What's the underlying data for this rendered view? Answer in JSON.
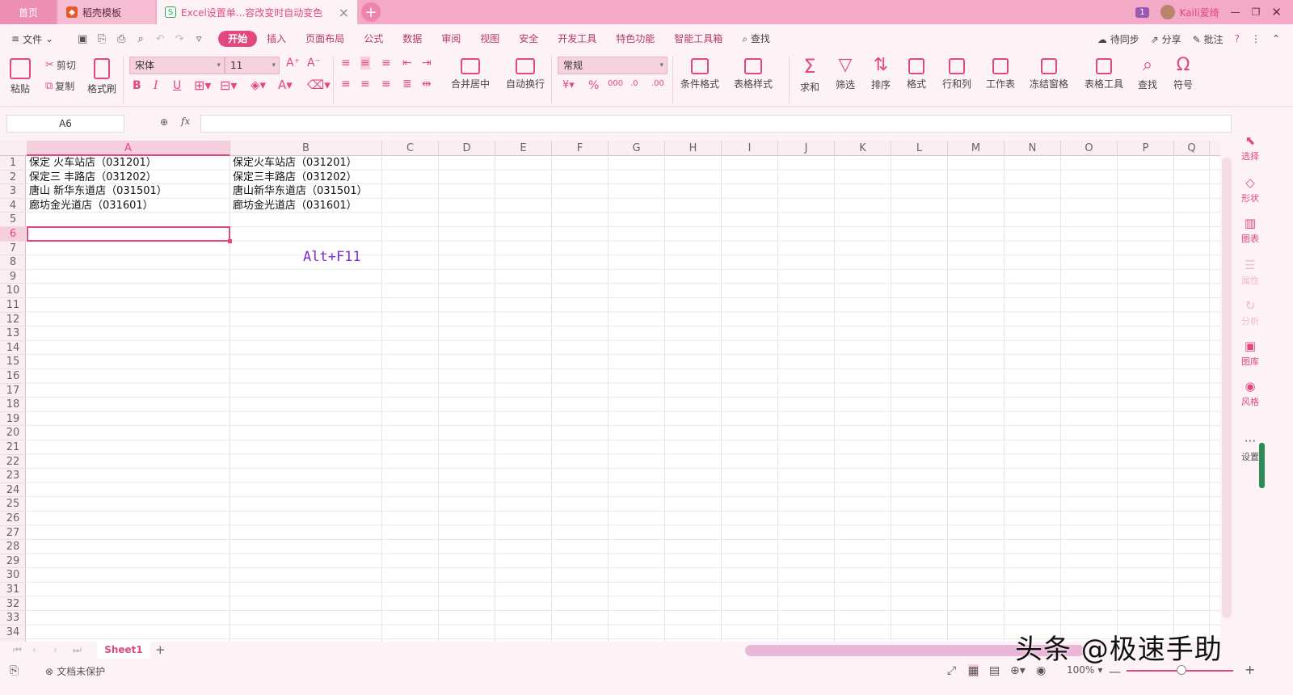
{
  "tabs": {
    "home": "首页",
    "template": "稻壳模板",
    "active_doc": "Excel设置单...容改变时自动变色",
    "new_tab_icon": "plus-icon"
  },
  "window": {
    "badge_count": "1",
    "username": "Kaili爱绮"
  },
  "menu": {
    "file": "文件",
    "tabs": [
      "开始",
      "插入",
      "页面布局",
      "公式",
      "数据",
      "审阅",
      "视图",
      "安全",
      "开发工具",
      "特色功能",
      "智能工具箱"
    ],
    "search": "查找",
    "sync": "待同步",
    "share": "分享",
    "comment": "批注"
  },
  "ribbon": {
    "paste": "粘贴",
    "cut": "剪切",
    "copy": "复制",
    "format_painter": "格式刷",
    "font_name": "宋体",
    "font_size": "11",
    "merge_center": "合并居中",
    "wrap_text": "自动换行",
    "number_format": "常规",
    "conditional_format": "条件格式",
    "table_style": "表格样式",
    "sum": "求和",
    "filter": "筛选",
    "sort": "排序",
    "format": "格式",
    "row_col": "行和列",
    "worksheet": "工作表",
    "freeze": "冻结窗格",
    "table_tools": "表格工具",
    "find": "查找",
    "symbol": "符号"
  },
  "formula_bar": {
    "name_box": "A6",
    "fx": "fx",
    "formula": ""
  },
  "grid": {
    "columns": [
      "A",
      "B",
      "C",
      "D",
      "E",
      "F",
      "G",
      "H",
      "I",
      "J",
      "K",
      "L",
      "M",
      "N",
      "O",
      "P",
      "Q"
    ],
    "rows": [
      "1",
      "2",
      "3",
      "4",
      "5",
      "6",
      "7",
      "8",
      "9",
      "10",
      "11",
      "12",
      "13",
      "14",
      "15",
      "16",
      "17",
      "18",
      "19",
      "20",
      "21",
      "22",
      "23",
      "24",
      "25",
      "26",
      "27",
      "28",
      "29",
      "30",
      "31",
      "32",
      "33",
      "34"
    ],
    "cells": {
      "A1": "保定 火车站店（031201）",
      "A2": "保定三 丰路店（031202）",
      "A3": "唐山 新华东道店（031501）",
      "A4": "廊坊金光道店（031601）",
      "B1": "保定火车站店（031201）",
      "B2": "保定三丰路店（031202）",
      "B3": "唐山新华东道店（031501）",
      "B4": "廊坊金光道店（031601）"
    },
    "selected_cell": "A6",
    "overlay_text": "Alt+F11"
  },
  "side_panel": [
    "选择",
    "形状",
    "图表",
    "属性",
    "分析",
    "图库",
    "风格",
    "设置"
  ],
  "sheets": {
    "active": "Sheet1",
    "add_icon": "plus-icon"
  },
  "status": {
    "protection": "文档未保护",
    "zoom": "100%"
  },
  "watermark": "头条 @极速手助",
  "colors": {
    "accent": "#e2487f",
    "tabbar": "#f4a9c6",
    "background": "#fdf3f7"
  }
}
